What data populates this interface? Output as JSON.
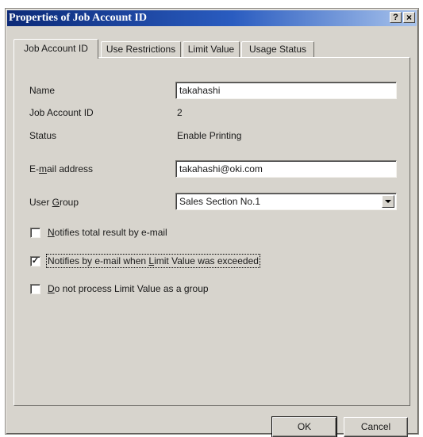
{
  "window": {
    "title": "Properties of Job Account ID",
    "help_button": "?",
    "close_button": "×"
  },
  "tabs": [
    {
      "label": "Job Account ID",
      "active": true
    },
    {
      "label": "Use Restrictions",
      "active": false
    },
    {
      "label": "Limit Value",
      "active": false
    },
    {
      "label": "Usage Status",
      "active": false
    }
  ],
  "form": {
    "name": {
      "label": "Name",
      "value": "takahashi"
    },
    "job_account_id": {
      "label": "Job Account ID",
      "value": "2"
    },
    "status": {
      "label": "Status",
      "value": "Enable Printing"
    },
    "email": {
      "label_pre": "E-",
      "label_u": "m",
      "label_post": "ail address",
      "value": "takahashi@oki.com"
    },
    "user_group": {
      "label_pre": "User ",
      "label_u": "G",
      "label_post": "roup",
      "value": "Sales Section No.1"
    }
  },
  "checkboxes": [
    {
      "pre": "",
      "u": "N",
      "post": "otifies total result by e-mail",
      "checked": false
    },
    {
      "pre": "Notifies by e-mail when ",
      "u": "L",
      "post": "imit Value was exceeded",
      "checked": true
    },
    {
      "pre": "",
      "u": "D",
      "post": "o not process Limit Value as a group",
      "checked": false
    }
  ],
  "buttons": {
    "ok": "OK",
    "cancel": "Cancel"
  }
}
